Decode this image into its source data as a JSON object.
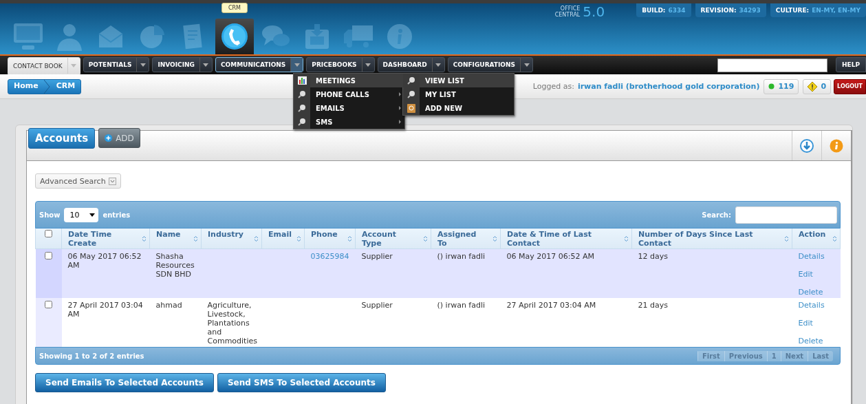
{
  "header": {
    "product": [
      "OFFICE",
      "CENTRAL"
    ],
    "version": "5.0",
    "info": [
      {
        "label": "BUILD:",
        "value": "6334"
      },
      {
        "label": "REVISION:",
        "value": "34293"
      },
      {
        "label": "CULTURE:",
        "value": "EN-MY, EN-MY"
      }
    ],
    "tooltip": "CRM",
    "modules": [
      {
        "kind": "monitor",
        "selected": false
      },
      {
        "kind": "person",
        "selected": false
      },
      {
        "kind": "envelope",
        "selected": false
      },
      {
        "kind": "pie",
        "selected": false
      },
      {
        "kind": "document",
        "selected": false
      },
      {
        "kind": "phone",
        "selected": true
      },
      {
        "kind": "chat",
        "selected": false
      },
      {
        "kind": "save",
        "selected": false
      },
      {
        "kind": "truck",
        "selected": false
      },
      {
        "kind": "info",
        "selected": false
      }
    ]
  },
  "nav": {
    "tabs": [
      {
        "label": "CONTACT BOOK",
        "selected": true,
        "open": false
      },
      {
        "label": "POTENTIALS",
        "selected": false,
        "open": false
      },
      {
        "label": "INVOICING",
        "selected": false,
        "open": false
      },
      {
        "label": "COMMUNICATIONS",
        "selected": false,
        "open": true
      },
      {
        "label": "PRICEBOOKS",
        "selected": false,
        "open": false
      },
      {
        "label": "DASHBOARD",
        "selected": false,
        "open": false
      },
      {
        "label": "CONFIGURATIONS",
        "selected": false,
        "open": false
      }
    ],
    "help": "HELP"
  },
  "menu": {
    "items": [
      {
        "label": "MEETINGS",
        "kind": "chart",
        "selected": true,
        "arrow": false
      },
      {
        "label": "PHONE CALLS",
        "kind": "search",
        "selected": false,
        "arrow": true
      },
      {
        "label": "EMAILS",
        "kind": "search",
        "selected": false,
        "arrow": true
      },
      {
        "label": "SMS",
        "kind": "search",
        "selected": false,
        "arrow": true
      }
    ],
    "submenu": [
      {
        "label": "VIEW LIST",
        "kind": "search",
        "selected": true
      },
      {
        "label": "MY LIST",
        "kind": "search",
        "selected": false
      },
      {
        "label": "ADD NEW",
        "kind": "book",
        "selected": false
      }
    ]
  },
  "bar": {
    "breadcrumb": [
      "Home",
      "CRM"
    ],
    "logged_label": "Logged as:",
    "user": "irwan fadli (brotherhood gold corporation)",
    "online": "119",
    "alerts": "0",
    "logout": "LOGOUT"
  },
  "panel": {
    "title": "Accounts",
    "add": "ADD",
    "advanced_search": "Advanced Search",
    "show": "Show",
    "page_size": "10",
    "entries": "entries",
    "search_label": "Search:",
    "select_all": {
      "checked": false
    },
    "columns": [
      "Date Time Create",
      "Name",
      "Industry",
      "Email",
      "Phone",
      "Account Type",
      "Assigned To",
      "Date & Time of Last Contact",
      "Number of Days Since Last Contact",
      "Action"
    ],
    "rows": [
      {
        "checked": false,
        "cells": [
          "06 May 2017 06:52 AM",
          "Shasha Resources SDN BHD",
          "",
          "",
          "03625984",
          "Supplier",
          "() irwan fadli",
          "06 May 2017 06:52 AM",
          "12 days"
        ],
        "actions": [
          "Details",
          "Edit",
          "Delete"
        ]
      },
      {
        "checked": false,
        "cells": [
          "27 April 2017 03:04 AM",
          "ahmad",
          "Agriculture, Livestock, Plantations and Commodities",
          "",
          "",
          "Supplier",
          "() irwan fadli",
          "27 April 2017 03:04 AM",
          "21 days"
        ],
        "actions": [
          "Details",
          "Edit",
          "Delete"
        ]
      }
    ],
    "info": "Showing 1 to 2 of 2 entries",
    "pagination": [
      "First",
      "Previous",
      "1",
      "Next",
      "Last"
    ],
    "buttons": [
      "Send Emails To Selected Accounts",
      "Send SMS To Selected Accounts"
    ]
  }
}
